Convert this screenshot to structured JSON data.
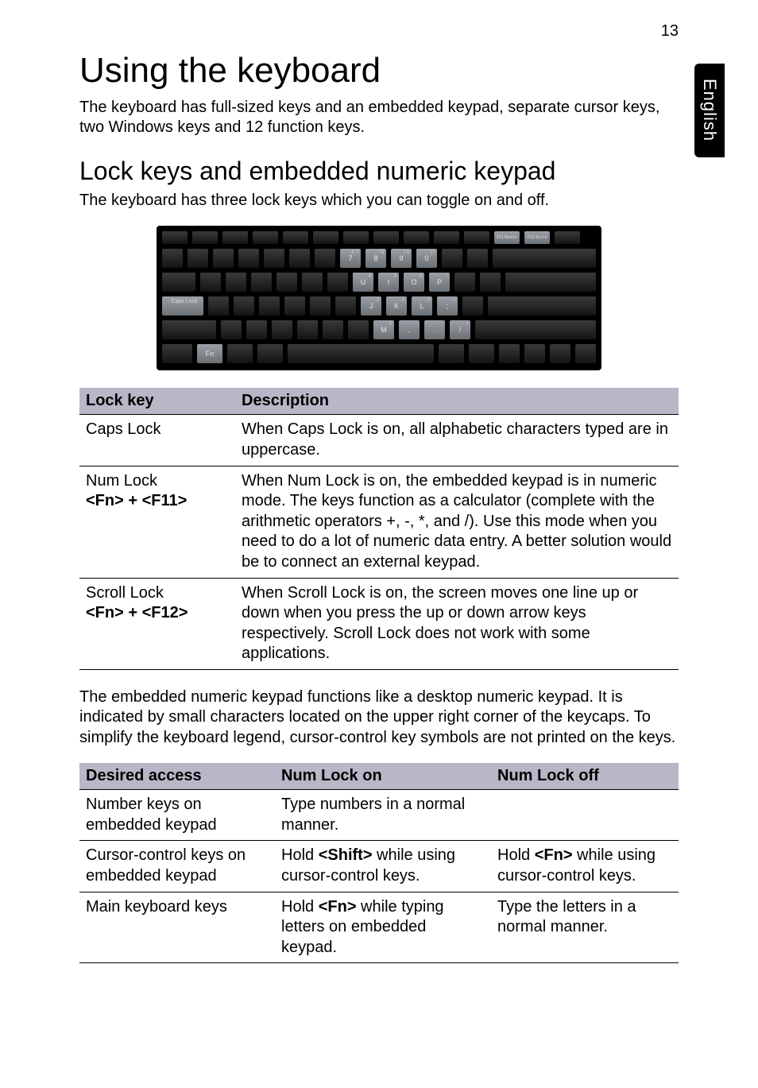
{
  "page_number": "13",
  "side_tab": "English",
  "h1": "Using the keyboard",
  "intro": "The keyboard has full-sized keys and an embedded keypad, separate cursor keys, two Windows keys and 12 function keys.",
  "h2": "Lock keys and embedded numeric keypad",
  "sub_intro": "The keyboard has three lock keys which you can toggle on and off.",
  "kb": {
    "f11": "F11 NumLk",
    "f12": "F12 Scr Lk",
    "caps": "Caps Lock",
    "fn": "Fn",
    "r2": [
      {
        "m": "7",
        "s": "& 7"
      },
      {
        "m": "8",
        "s": "* 8"
      },
      {
        "m": "9",
        "s": "( 9"
      },
      {
        "m": "0",
        "s": ") *"
      }
    ],
    "r3": [
      {
        "m": "U",
        "s": "4"
      },
      {
        "m": "I",
        "s": "5"
      },
      {
        "m": "O",
        "s": "6"
      },
      {
        "m": "P",
        "s": "-"
      }
    ],
    "r4": [
      {
        "m": "J",
        "s": "1"
      },
      {
        "m": "K",
        "s": "2"
      },
      {
        "m": "L",
        "s": "3"
      },
      {
        "m": ";",
        "s": "+"
      }
    ],
    "r5": [
      {
        "m": "M",
        "s": "0"
      },
      {
        "m": ",",
        "s": ""
      },
      {
        "m": ".",
        "s": ""
      },
      {
        "m": "/",
        "s": "/"
      }
    ]
  },
  "table1": {
    "headers": [
      "Lock key",
      "Description"
    ],
    "rows": [
      {
        "key": "Caps Lock",
        "combo": "",
        "desc": "When Caps Lock is on, all alphabetic characters typed are in uppercase."
      },
      {
        "key": "Num Lock",
        "combo": "<Fn> + <F11>",
        "desc": "When Num Lock is on, the embedded keypad is in numeric mode. The keys function as a calculator (complete with the arithmetic operators +, -, *, and /). Use this mode when you need to do a lot of numeric data entry. A better solution would be to connect an external keypad."
      },
      {
        "key": "Scroll Lock",
        "combo": "<Fn> + <F12>",
        "desc": "When Scroll Lock is on, the screen moves one line up or down when you press the up or down arrow keys respectively. Scroll Lock does not work with some applications."
      }
    ]
  },
  "mid_para": "The embedded numeric keypad functions like a desktop numeric keypad. It is indicated by small characters located on the upper right corner of the keycaps. To simplify the keyboard legend, cursor-control key symbols are not printed on the keys.",
  "table2": {
    "headers": [
      "Desired access",
      "Num Lock on",
      "Num Lock off"
    ],
    "rows": [
      {
        "c1": "Number keys on embedded keypad",
        "c2_pre": "Type numbers in a normal manner.",
        "c2_bold": "",
        "c2_post": "",
        "c3_pre": "",
        "c3_bold": "",
        "c3_post": ""
      },
      {
        "c1": "Cursor-control keys on embedded keypad",
        "c2_pre": "Hold ",
        "c2_bold": "<Shift>",
        "c2_post": " while using cursor-control keys.",
        "c3_pre": "Hold ",
        "c3_bold": "<Fn>",
        "c3_post": " while using cursor-control keys."
      },
      {
        "c1": "Main keyboard keys",
        "c2_pre": "Hold ",
        "c2_bold": "<Fn>",
        "c2_post": " while typing letters on embedded keypad.",
        "c3_pre": "Type the letters in a normal manner.",
        "c3_bold": "",
        "c3_post": ""
      }
    ]
  }
}
